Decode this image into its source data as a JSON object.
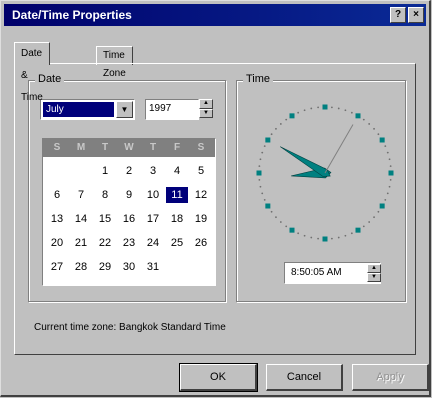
{
  "window": {
    "title": "Date/Time Properties"
  },
  "title_buttons": {
    "help": "?",
    "close": "×"
  },
  "tabs": [
    {
      "label": "Date & Time",
      "active": true
    },
    {
      "label": "Time Zone",
      "active": false
    }
  ],
  "date_group": {
    "label": "Date"
  },
  "time_group": {
    "label": "Time"
  },
  "month_select": {
    "value": "July"
  },
  "year_field": {
    "value": "1997"
  },
  "calendar": {
    "weekdays": [
      "S",
      "M",
      "T",
      "W",
      "T",
      "F",
      "S"
    ],
    "selected_day": 11,
    "weeks": [
      [
        "",
        "",
        "1",
        "2",
        "3",
        "4",
        "5"
      ],
      [
        "6",
        "7",
        "8",
        "9",
        "10",
        "11",
        "12"
      ],
      [
        "13",
        "14",
        "15",
        "16",
        "17",
        "18",
        "19"
      ],
      [
        "20",
        "21",
        "22",
        "23",
        "24",
        "25",
        "26"
      ],
      [
        "27",
        "28",
        "29",
        "30",
        "31",
        "",
        ""
      ]
    ]
  },
  "clock": {
    "hour": 8,
    "minute": 50,
    "second": 5,
    "hand_color": "#008080",
    "dot_color": "#008080"
  },
  "time_field": {
    "value": "8:50:05 AM"
  },
  "timezone_text": "Current time zone: Bangkok Standard Time",
  "buttons": {
    "ok": "OK",
    "cancel": "Cancel",
    "apply": "Apply"
  }
}
